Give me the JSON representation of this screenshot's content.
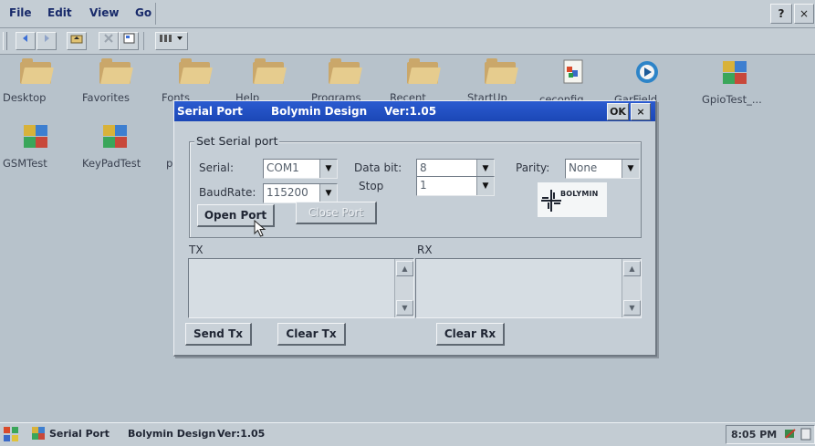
{
  "menubar": {
    "items": [
      "File",
      "Edit",
      "View",
      "Go"
    ],
    "help_label": "?",
    "close_label": "×"
  },
  "toolbar": {
    "back_icon": "back-icon",
    "forward_icon": "forward-icon",
    "up_icon": "up-folder-icon",
    "delete_icon": "delete-icon",
    "properties_icon": "properties-icon",
    "views_icon": "views-icon"
  },
  "desktop": {
    "icons_row1": [
      "Desktop",
      "Favorites",
      "Fonts",
      "Help",
      "Programs",
      "Recent",
      "StartUp",
      "ceconfig",
      "GarField",
      "GpioTest_..."
    ],
    "icons_row2": [
      "GSMTest",
      "KeyPadTest",
      "p"
    ]
  },
  "dialog": {
    "title": "Serial Port",
    "title_company": "Bolymin Design",
    "title_version": "Ver:1.05",
    "ok_label": "OK",
    "close_label": "×",
    "group_label": "Set Serial port",
    "serial_label": "Serial:",
    "serial_value": "COM1",
    "databit_label": "Data bit:",
    "databit_value": "8",
    "parity_label": "Parity:",
    "parity_value": "None",
    "baud_label": "BaudRate:",
    "baud_value": "115200",
    "stop_label": "Stop",
    "stop_value": "1",
    "open_port_label": "Open Port",
    "close_port_label": "Close Port",
    "logo_text": "BOLYMIN",
    "tx_label": "TX",
    "rx_label": "RX",
    "send_tx_label": "Send Tx",
    "clear_tx_label": "Clear Tx",
    "clear_rx_label": "Clear Rx"
  },
  "taskbar": {
    "task_title": "Serial Port",
    "task_company": "Bolymin Design",
    "task_version": "Ver:1.05",
    "clock": "8:05 PM"
  },
  "colors": {
    "titlebar": "#1b47b6",
    "desktop": "#b7c2cb",
    "dialog": "#c5ced6"
  }
}
